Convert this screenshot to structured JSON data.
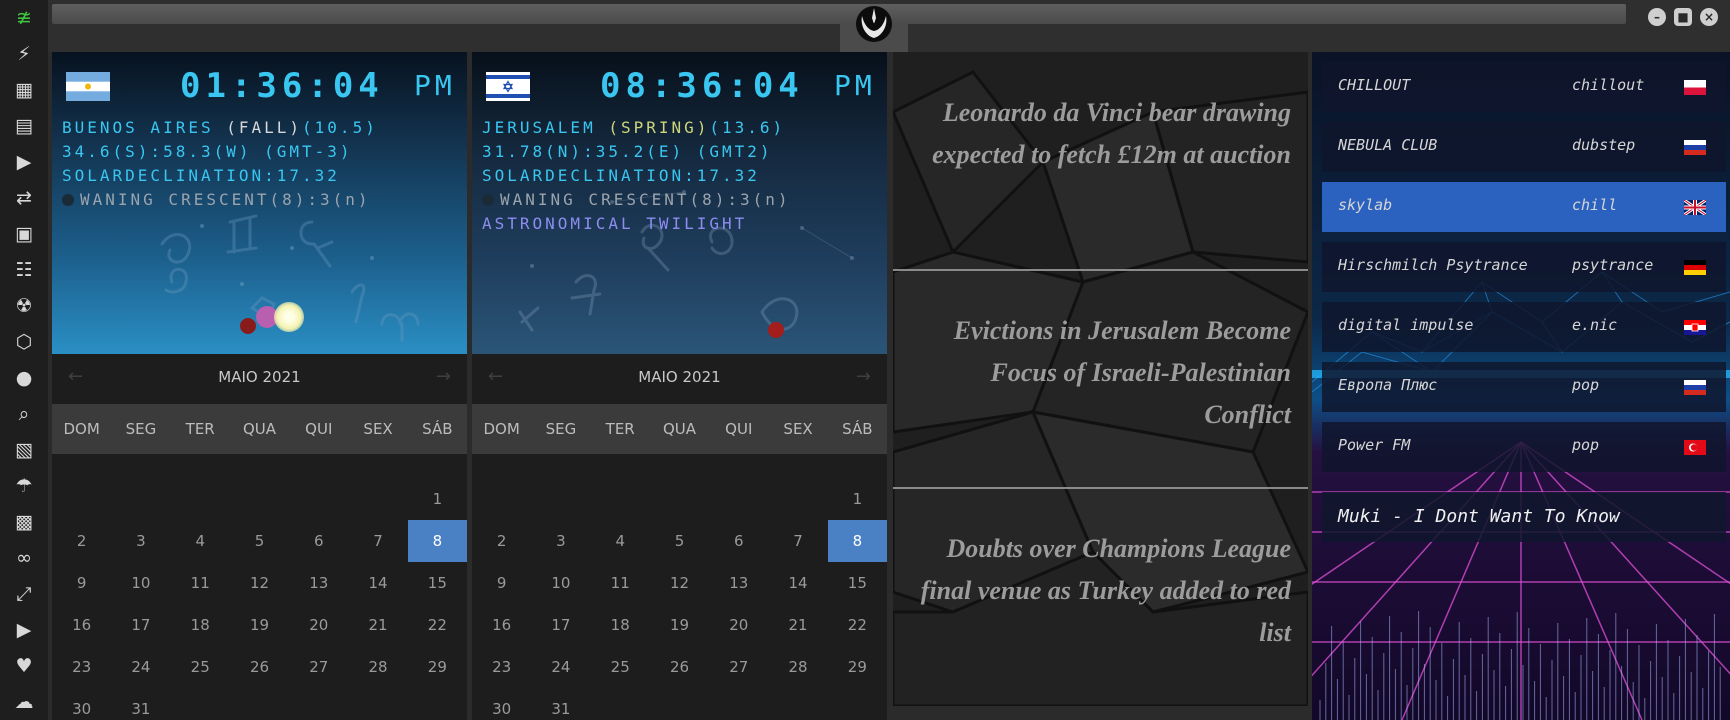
{
  "sidebar": {
    "icons": [
      "wifi-icon",
      "lightning-icon",
      "windows-icon",
      "archive-icon",
      "play-icon",
      "translate-icon",
      "image-icon",
      "news-icon",
      "radiation-icon",
      "hexagon-icon",
      "globe-icon",
      "search-icon",
      "map-icon",
      "umbrella-icon",
      "contact-icon",
      "link-icon",
      "fullscreen-icon",
      "youtube-icon",
      "heart-icon",
      "cloud-icon"
    ]
  },
  "window": {
    "emblem": "rebel-alliance-emblem",
    "buttons": [
      "minimize-icon",
      "maximize-icon",
      "close-icon"
    ]
  },
  "clocks": [
    {
      "time": "01:36:04",
      "ampm": "PM",
      "flag": "argentina",
      "city": "BUENOS AIRES ",
      "season": "(FALL)",
      "temp": "(10.5)",
      "coords": "34.6(S):58.3(W) (GMT-3)",
      "solar": "SOLARDECLINATION:17.32",
      "moon": "WANING CRESCENT(8):3",
      "moon_suffix": "(n)"
    },
    {
      "time": "08:36:04",
      "ampm": "PM",
      "flag": "israel",
      "city": "JERUSALEM ",
      "season": "(SPRING)",
      "temp": "(13.6)",
      "coords": "31.78(N):35.2(E) (GMT2)",
      "solar": "SOLARDECLINATION:17.32",
      "moon": "WANING CRESCENT(8):3",
      "moon_suffix": "(n)",
      "twilight": "ASTRONOMICAL TWILIGHT"
    }
  ],
  "calendar": {
    "month": "MAIO 2021",
    "prev": "←",
    "next": "→",
    "weekdays": [
      "DOM",
      "SEG",
      "TER",
      "QUA",
      "QUI",
      "SEX",
      "SÁB"
    ],
    "first_weekday": 6,
    "days_in_month": 31,
    "today": 8,
    "today_color": "#4a80c4"
  },
  "news": {
    "headlines": [
      "Leonardo da Vinci bear drawing expected to fetch £12m at auction",
      "Evictions in Jerusalem Become Focus of Israeli-Palestinian Conflict",
      "Doubts over Champions League final venue as Turkey added to red list"
    ]
  },
  "radio": {
    "stations": [
      {
        "name": "CHILLOUT",
        "genre": "chillout",
        "flag": "poland"
      },
      {
        "name": "NEBULA CLUB",
        "genre": "dubstep",
        "flag": "russia"
      },
      {
        "name": "skylab",
        "genre": "chill",
        "flag": "uk",
        "active": true
      },
      {
        "name": "Hirschmilch Psytrance",
        "genre": "psytrance",
        "flag": "germany"
      },
      {
        "name": "digital impulse",
        "genre": "e.nic",
        "flag": "croatia"
      },
      {
        "name": "Европа Плюс",
        "genre": "pop",
        "flag": "russia"
      },
      {
        "name": "Power FM",
        "genre": "pop",
        "flag": "turkey"
      }
    ],
    "now_playing": "Muki - I Dont Want To Know"
  },
  "colors": {
    "digital_cyan": "#39c6f0",
    "accent_blue": "#4a80c4",
    "active_station": "#2c62bf"
  }
}
